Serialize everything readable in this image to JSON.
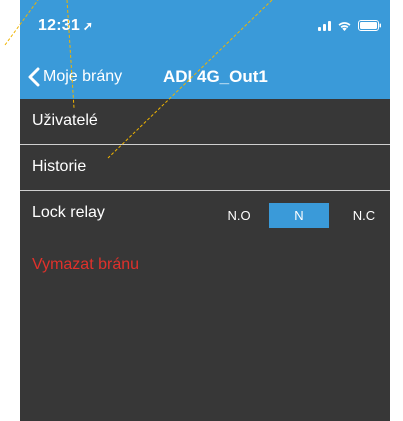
{
  "status_bar": {
    "time": "12:31",
    "location_arrow": "➚",
    "icons": [
      "signal-icon",
      "wifi-icon",
      "battery-icon"
    ]
  },
  "nav": {
    "back_label": "Moje brány",
    "title": "ADI 4G_Out1"
  },
  "list": {
    "users_label": "Uživatelé",
    "history_label": "Historie",
    "lock_relay": {
      "label": "Lock relay",
      "options": [
        "N.O",
        "N",
        "N.C"
      ],
      "selected": "N"
    }
  },
  "delete_label": "Vymazat bránu",
  "colors": {
    "accent": "#3a9ad9",
    "background": "#373737",
    "danger": "#e0312b",
    "annotation": "#f0b400"
  }
}
